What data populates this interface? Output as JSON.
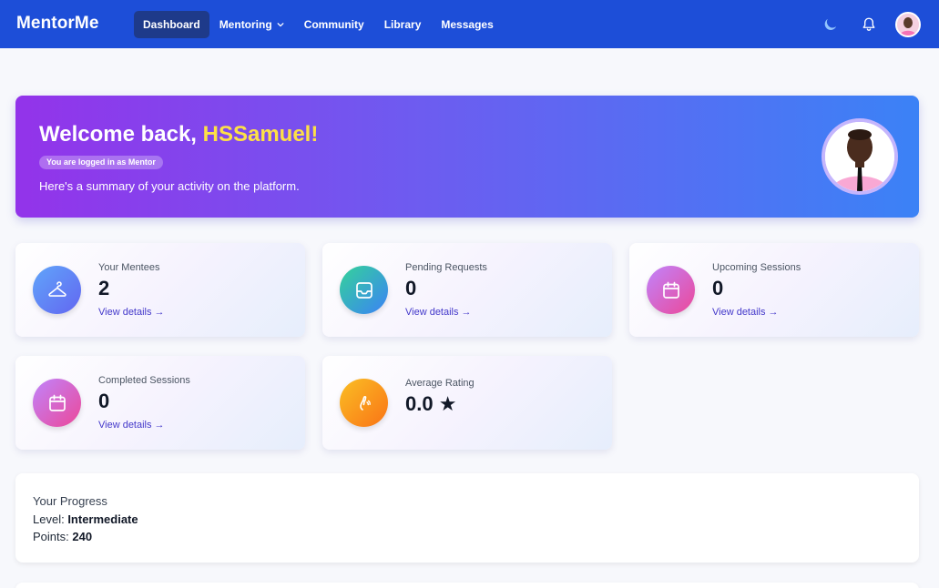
{
  "app": {
    "brand": "MentorMe"
  },
  "nav": {
    "items": [
      {
        "label": "Dashboard",
        "active": true
      },
      {
        "label": "Mentoring",
        "has_dropdown": true
      },
      {
        "label": "Community"
      },
      {
        "label": "Library"
      },
      {
        "label": "Messages"
      }
    ],
    "icons": [
      "moon-icon",
      "bell-icon",
      "user-avatar"
    ]
  },
  "hero": {
    "greeting": "Welcome back, ",
    "name": "HSSamuel!",
    "role_badge": "You are logged in as Mentor",
    "subtitle": "Here's a summary of your activity on the platform.",
    "colors": {
      "gradient_start": "#9333ea",
      "gradient_end": "#3b82f6",
      "name": "#fde047"
    }
  },
  "stats": [
    {
      "label": "Your Mentees",
      "value": "2",
      "link": "View details →",
      "icon": "hanger-icon"
    },
    {
      "label": "Pending Requests",
      "value": "0",
      "link": "View details →",
      "icon": "inbox-icon"
    },
    {
      "label": "Upcoming Sessions",
      "value": "0",
      "link": "View details →",
      "icon": "calendar-icon"
    },
    {
      "label": "Completed Sessions",
      "value": "0",
      "link": "View details →",
      "icon": "calendar-icon"
    },
    {
      "label": "Average Rating",
      "value": "0.0 ★",
      "icon": "hand-icon"
    }
  ],
  "progress": {
    "title": "Your Progress",
    "level_label": "Level: ",
    "level_value": "Intermediate",
    "points_label": "Points: ",
    "points_value": "240"
  }
}
